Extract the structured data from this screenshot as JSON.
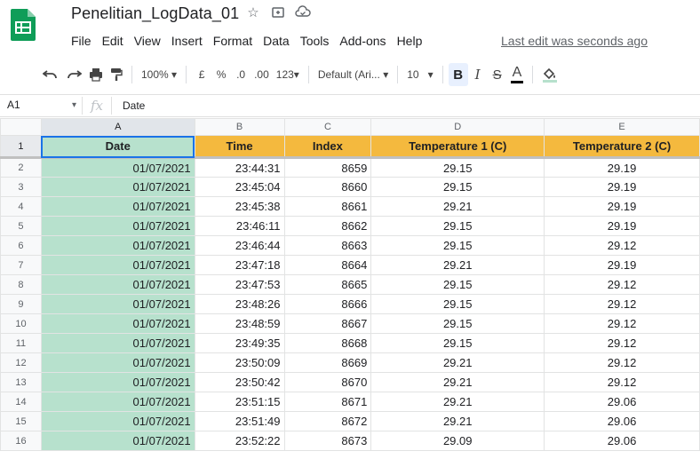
{
  "document": {
    "title": "Penelitian_LogData_01",
    "last_edit": "Last edit was seconds ago"
  },
  "menu": [
    "File",
    "Edit",
    "View",
    "Insert",
    "Format",
    "Data",
    "Tools",
    "Add-ons",
    "Help"
  ],
  "toolbar": {
    "zoom": "100%",
    "currency": "£",
    "percent": "%",
    "decrease_decimal": ".0",
    "increase_decimal": ".00",
    "more_formats": "123",
    "font": "Default (Ari...",
    "font_size": "10",
    "bold": "B",
    "italic": "I",
    "strike": "S",
    "text_color": "A"
  },
  "formula_bar": {
    "cell_ref": "A1",
    "fx": "fx",
    "content": "Date"
  },
  "sheet": {
    "column_letters": [
      "A",
      "B",
      "C",
      "D",
      "E"
    ],
    "header_row_number": "1",
    "headers": [
      "Date",
      "Time",
      "Index",
      "Temperature 1 (C)",
      "Temperature 2 (C)"
    ],
    "rows": [
      {
        "n": "2",
        "date": "01/07/2021",
        "time": "23:44:31",
        "index": "8659",
        "t1": "29.15",
        "t2": "29.19"
      },
      {
        "n": "3",
        "date": "01/07/2021",
        "time": "23:45:04",
        "index": "8660",
        "t1": "29.15",
        "t2": "29.19"
      },
      {
        "n": "4",
        "date": "01/07/2021",
        "time": "23:45:38",
        "index": "8661",
        "t1": "29.21",
        "t2": "29.19"
      },
      {
        "n": "5",
        "date": "01/07/2021",
        "time": "23:46:11",
        "index": "8662",
        "t1": "29.15",
        "t2": "29.19"
      },
      {
        "n": "6",
        "date": "01/07/2021",
        "time": "23:46:44",
        "index": "8663",
        "t1": "29.15",
        "t2": "29.12"
      },
      {
        "n": "7",
        "date": "01/07/2021",
        "time": "23:47:18",
        "index": "8664",
        "t1": "29.21",
        "t2": "29.19"
      },
      {
        "n": "8",
        "date": "01/07/2021",
        "time": "23:47:53",
        "index": "8665",
        "t1": "29.15",
        "t2": "29.12"
      },
      {
        "n": "9",
        "date": "01/07/2021",
        "time": "23:48:26",
        "index": "8666",
        "t1": "29.15",
        "t2": "29.12"
      },
      {
        "n": "10",
        "date": "01/07/2021",
        "time": "23:48:59",
        "index": "8667",
        "t1": "29.15",
        "t2": "29.12"
      },
      {
        "n": "11",
        "date": "01/07/2021",
        "time": "23:49:35",
        "index": "8668",
        "t1": "29.15",
        "t2": "29.12"
      },
      {
        "n": "12",
        "date": "01/07/2021",
        "time": "23:50:09",
        "index": "8669",
        "t1": "29.21",
        "t2": "29.12"
      },
      {
        "n": "13",
        "date": "01/07/2021",
        "time": "23:50:42",
        "index": "8670",
        "t1": "29.21",
        "t2": "29.12"
      },
      {
        "n": "14",
        "date": "01/07/2021",
        "time": "23:51:15",
        "index": "8671",
        "t1": "29.21",
        "t2": "29.06"
      },
      {
        "n": "15",
        "date": "01/07/2021",
        "time": "23:51:49",
        "index": "8672",
        "t1": "29.21",
        "t2": "29.06"
      },
      {
        "n": "16",
        "date": "01/07/2021",
        "time": "23:52:22",
        "index": "8673",
        "t1": "29.09",
        "t2": "29.06"
      }
    ]
  },
  "colors": {
    "header_fill": "#f4b93e",
    "date_fill": "#b7e1cd",
    "selection": "#1a73e8",
    "sheets_green": "#0f9d58"
  }
}
